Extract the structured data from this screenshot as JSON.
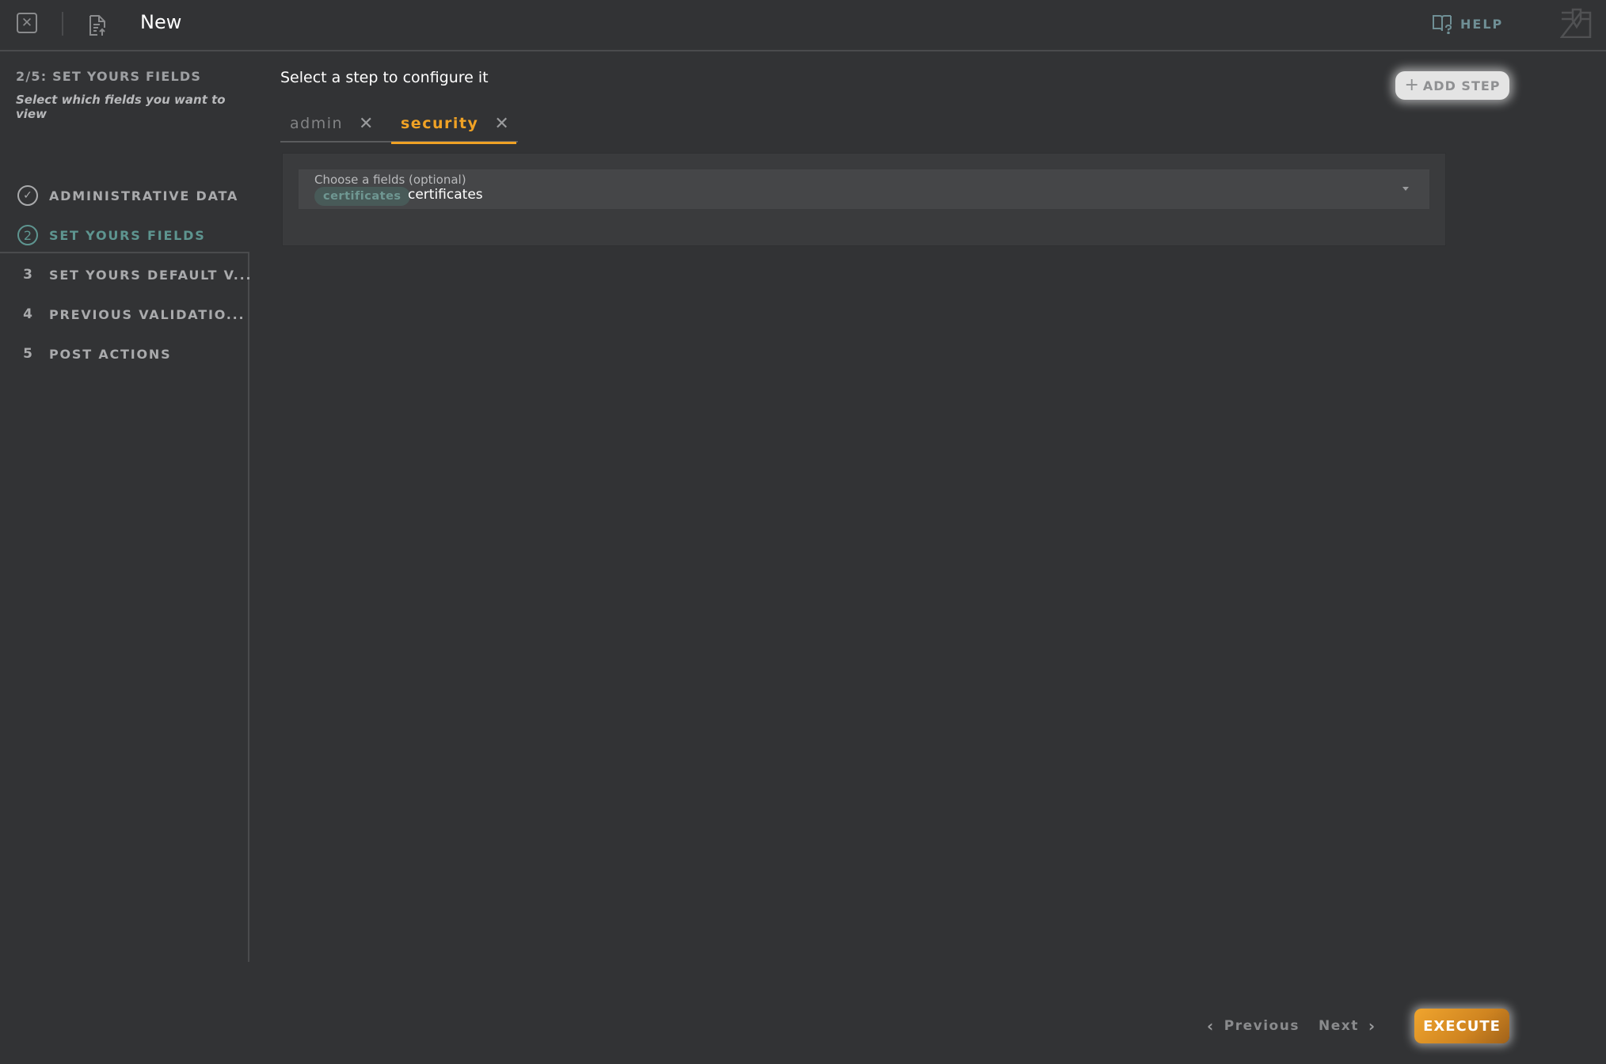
{
  "header": {
    "close_icon": "close-square-icon",
    "document_icon": "document-upload-icon",
    "title": "New",
    "help_label": "HELP",
    "help_icon": "book-question-icon",
    "save_icon": "tray-download-icon"
  },
  "sidebar": {
    "step_title": "2/5: SET YOURS FIELDS",
    "subtitle": "Select which fields you want to view",
    "steps": [
      {
        "marker": "check-circle-icon",
        "label": "ADMINISTRATIVE DATA",
        "status": "completed"
      },
      {
        "marker": "2",
        "label": "SET YOURS FIELDS",
        "status": "active"
      },
      {
        "marker": "3",
        "label": "SET YOURS DEFAULT V...",
        "status": "pending"
      },
      {
        "marker": "4",
        "label": "PREVIOUS VALIDATIO...",
        "status": "pending"
      },
      {
        "marker": "5",
        "label": "POST ACTIONS",
        "status": "pending"
      }
    ]
  },
  "main": {
    "heading": "Select a step to configure it",
    "add_step_label": "ADD STEP",
    "add_step_icon": "+",
    "tabs": [
      {
        "label": "admin",
        "active": false
      },
      {
        "label": "security",
        "active": true
      }
    ],
    "tab_close_glyph": "✕",
    "field": {
      "label": "Choose a fields (optional)",
      "chip": "certificates",
      "value": "certificates"
    }
  },
  "footer": {
    "previous_label": "Previous",
    "next_label": "Next",
    "execute_label": "EXECUTE"
  },
  "colors": {
    "background": "#323335",
    "accent_orange": "#f0a225",
    "accent_teal": "#5e9590",
    "muted_text": "#a9aaac"
  }
}
